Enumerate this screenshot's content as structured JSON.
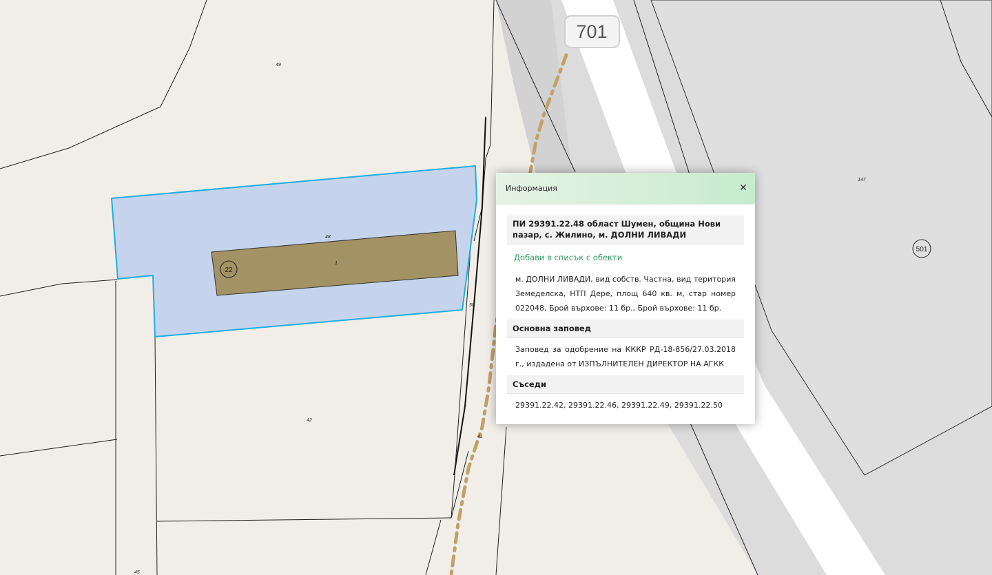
{
  "map": {
    "road_number": "701",
    "parcel_labels": {
      "p49": "49",
      "p48": "48",
      "p1": "1",
      "p50": "50",
      "p42": "42",
      "p41": "41",
      "p45": "45",
      "p147": "147"
    },
    "circle_labels": {
      "c22": "22",
      "c501": "501"
    },
    "colors": {
      "background": "#f1eee8",
      "selected_fill": "#c5d4ec",
      "selected_outline": "#1eaee0",
      "building_fill": "#a39263",
      "road_band": "#dcdcdc",
      "road_center": "#ffffff",
      "path_dashes": "#c3a06b"
    }
  },
  "panel": {
    "title": "Информация",
    "close_icon": "close-icon",
    "heading": "ПИ 29391.22.48 област Шумен, община Нови пазар, с. Жилино, м. ДОЛНИ ЛИВАДИ",
    "add_link": "Добави в списък с обекти",
    "description": "м. ДОЛНИ ЛИВАДИ, вид собств. Частна, вид територия Земеделска, НТП Дере, площ 640 кв. м, стар номер 022048, Брой върхове: 11 бр., Брой върхове: 11 бр.",
    "order_heading": "Основна заповед",
    "order_text": "Заповед за одобрение на КККР РД-18-856/27.03.2018 г., издадена от ИЗПЪЛНИТЕЛЕН ДИРЕКТОР НА АГКК",
    "neighbors_heading": "Съседи",
    "neighbors_text": "29391.22.42, 29391.22.46, 29391.22.49, 29391.22.50"
  }
}
